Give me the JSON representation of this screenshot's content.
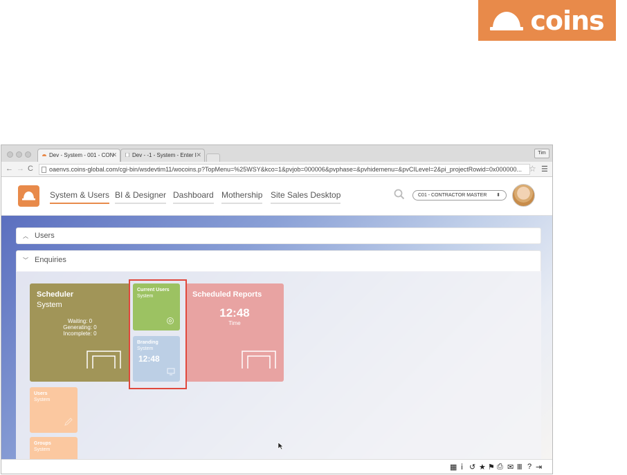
{
  "brand": {
    "logo_text": "coins",
    "color": "#e88a4a"
  },
  "browser": {
    "tabs": [
      {
        "label": "Dev - System - 001 - CON"
      },
      {
        "label": "Dev - -1 - System - Enter I"
      }
    ],
    "user_chip": "Tim",
    "url": "oaenvs.coins-global.com/cgi-bin/wsdevtim11/wocoins.p?TopMenu=%25WSY&kco=1&pvjob=000006&pvphase=&pvhidemenu=&pvCILevel=2&pi_projectRowid=0x000000..."
  },
  "nav": {
    "items": [
      {
        "label": "System & Users",
        "active": true
      },
      {
        "label": "BI & Designer"
      },
      {
        "label": "Dashboard"
      },
      {
        "label": "Mothership"
      },
      {
        "label": "Site Sales Desktop"
      }
    ],
    "company": "C01 - CONTRACTOR MASTER",
    "search_icon": "search-icon"
  },
  "panels": {
    "users": "Users",
    "enquiries": "Enquiries"
  },
  "tiles": {
    "scheduler": {
      "title": "Scheduler",
      "subtitle": "System",
      "waiting": "Waiting: 0",
      "generating": "Generating: 0",
      "incomplete": "Incomplete: 0"
    },
    "current_users": {
      "title": "Current Users",
      "subtitle": "System"
    },
    "branding": {
      "title": "Branding",
      "subtitle": "System",
      "time": "12:48"
    },
    "scheduled_reports": {
      "title": "Scheduled Reports",
      "time": "12:48",
      "time_label": "Time"
    },
    "users": {
      "title": "Users",
      "subtitle": "System"
    },
    "groups": {
      "title": "Groups",
      "subtitle": "System"
    }
  },
  "colors": {
    "scheduler": "#a19558",
    "scheduled_reports": "#e8a3a2",
    "current_users": "#9cc262",
    "branding": "#bccfe5",
    "users": "#fbc8a0",
    "highlight": "#e0483c"
  }
}
